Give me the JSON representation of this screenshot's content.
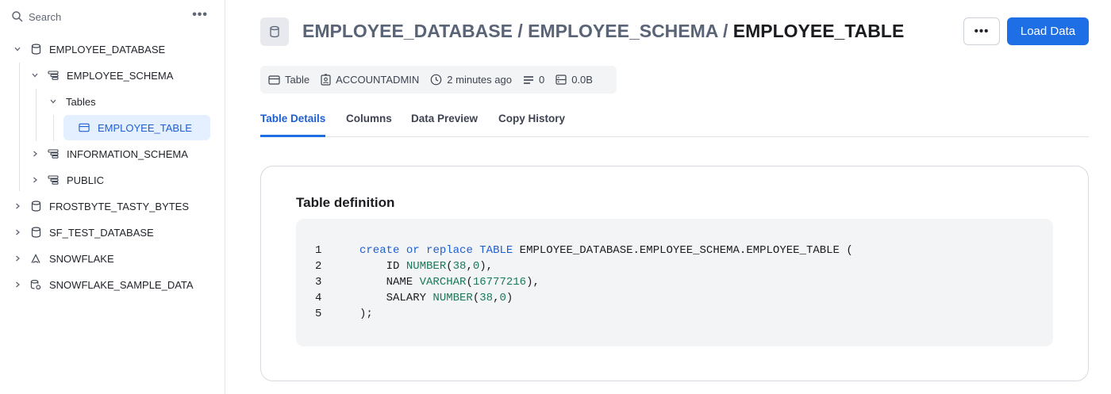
{
  "sidebar": {
    "search_placeholder": "Search",
    "more": "•••",
    "tree": [
      {
        "label": "EMPLOYEE_DATABASE"
      },
      {
        "label": "EMPLOYEE_SCHEMA"
      },
      {
        "label": "Tables"
      },
      {
        "label": "EMPLOYEE_TABLE"
      },
      {
        "label": "INFORMATION_SCHEMA"
      },
      {
        "label": "PUBLIC"
      },
      {
        "label": "FROSTBYTE_TASTY_BYTES"
      },
      {
        "label": "SF_TEST_DATABASE"
      },
      {
        "label": "SNOWFLAKE"
      },
      {
        "label": "SNOWFLAKE_SAMPLE_DATA"
      }
    ]
  },
  "header": {
    "db": "EMPLOYEE_DATABASE",
    "sep": "/",
    "schema": "EMPLOYEE_SCHEMA",
    "table": "EMPLOYEE_TABLE",
    "more": "•••",
    "load_button": "Load Data"
  },
  "meta": {
    "type": "Table",
    "owner": "ACCOUNTADMIN",
    "updated": "2 minutes ago",
    "rows": "0",
    "size": "0.0B"
  },
  "tabs": [
    {
      "label": "Table Details"
    },
    {
      "label": "Columns"
    },
    {
      "label": "Data Preview"
    },
    {
      "label": "Copy History"
    }
  ],
  "definition": {
    "title": "Table definition",
    "lines": [
      {
        "n": "1",
        "parts": [
          [
            "kw",
            "create"
          ],
          [
            "",
            ""
          ],
          [
            "kw",
            " or"
          ],
          [
            "kw",
            " replace"
          ],
          [
            "kw",
            " TABLE"
          ],
          [
            "",
            " EMPLOYEE_DATABASE.EMPLOYEE_SCHEMA.EMPLOYEE_TABLE ("
          ]
        ]
      },
      {
        "n": "2",
        "parts": [
          [
            "",
            "    ID "
          ],
          [
            "ty",
            "NUMBER"
          ],
          [
            "",
            "("
          ],
          [
            "ty",
            "38"
          ],
          [
            "",
            ","
          ],
          [
            "ty",
            "0"
          ],
          [
            "",
            "),"
          ]
        ]
      },
      {
        "n": "3",
        "parts": [
          [
            "",
            "    NAME "
          ],
          [
            "ty",
            "VARCHAR"
          ],
          [
            "",
            "("
          ],
          [
            "ty",
            "16777216"
          ],
          [
            "",
            "),"
          ]
        ]
      },
      {
        "n": "4",
        "parts": [
          [
            "",
            "    SALARY "
          ],
          [
            "ty",
            "NUMBER"
          ],
          [
            "",
            "("
          ],
          [
            "ty",
            "38"
          ],
          [
            "",
            ","
          ],
          [
            "ty",
            "0"
          ],
          [
            "",
            ")"
          ]
        ]
      },
      {
        "n": "5",
        "parts": [
          [
            "",
            ");"
          ]
        ]
      }
    ]
  },
  "colors": {
    "accent": "#1e6fe6",
    "selected_bg": "#e4efff",
    "keyword": "#1e5fd0",
    "type": "#1a7a58"
  }
}
